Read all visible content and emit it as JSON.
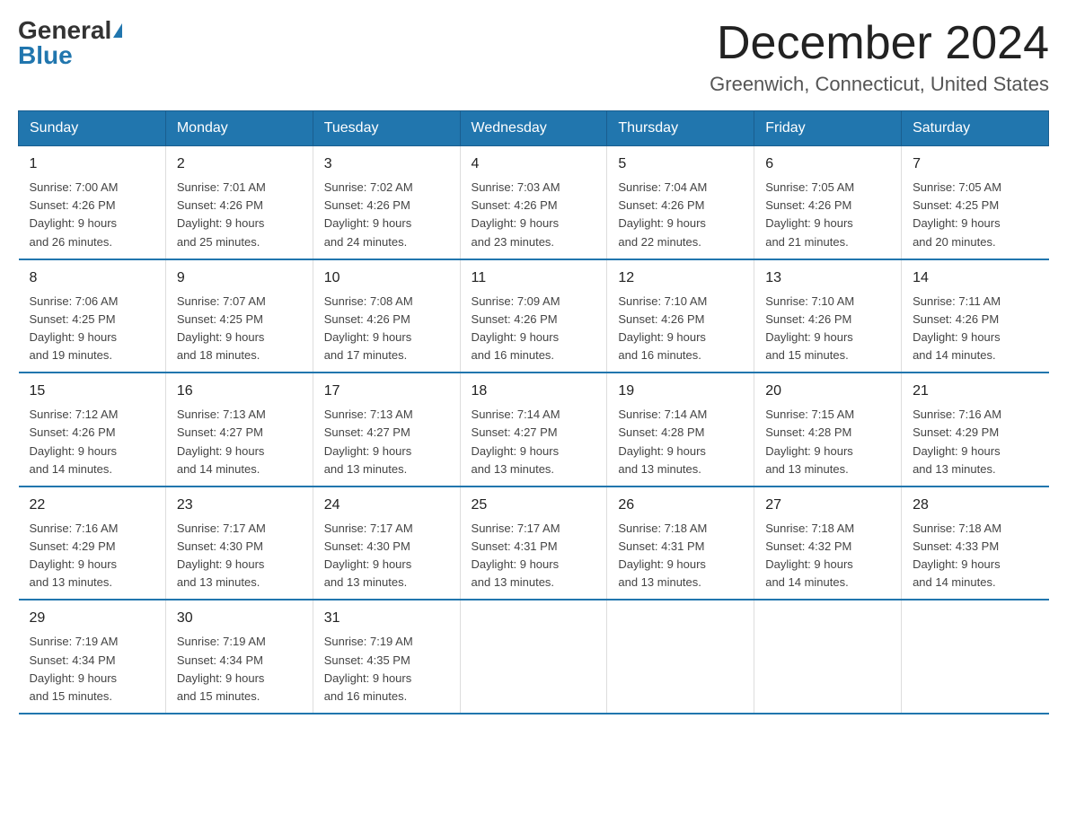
{
  "logo": {
    "general": "General",
    "blue": "Blue"
  },
  "header": {
    "month": "December 2024",
    "location": "Greenwich, Connecticut, United States"
  },
  "days_of_week": [
    "Sunday",
    "Monday",
    "Tuesday",
    "Wednesday",
    "Thursday",
    "Friday",
    "Saturday"
  ],
  "weeks": [
    [
      {
        "day": "1",
        "sunrise": "7:00 AM",
        "sunset": "4:26 PM",
        "daylight": "9 hours and 26 minutes."
      },
      {
        "day": "2",
        "sunrise": "7:01 AM",
        "sunset": "4:26 PM",
        "daylight": "9 hours and 25 minutes."
      },
      {
        "day": "3",
        "sunrise": "7:02 AM",
        "sunset": "4:26 PM",
        "daylight": "9 hours and 24 minutes."
      },
      {
        "day": "4",
        "sunrise": "7:03 AM",
        "sunset": "4:26 PM",
        "daylight": "9 hours and 23 minutes."
      },
      {
        "day": "5",
        "sunrise": "7:04 AM",
        "sunset": "4:26 PM",
        "daylight": "9 hours and 22 minutes."
      },
      {
        "day": "6",
        "sunrise": "7:05 AM",
        "sunset": "4:26 PM",
        "daylight": "9 hours and 21 minutes."
      },
      {
        "day": "7",
        "sunrise": "7:05 AM",
        "sunset": "4:25 PM",
        "daylight": "9 hours and 20 minutes."
      }
    ],
    [
      {
        "day": "8",
        "sunrise": "7:06 AM",
        "sunset": "4:25 PM",
        "daylight": "9 hours and 19 minutes."
      },
      {
        "day": "9",
        "sunrise": "7:07 AM",
        "sunset": "4:25 PM",
        "daylight": "9 hours and 18 minutes."
      },
      {
        "day": "10",
        "sunrise": "7:08 AM",
        "sunset": "4:26 PM",
        "daylight": "9 hours and 17 minutes."
      },
      {
        "day": "11",
        "sunrise": "7:09 AM",
        "sunset": "4:26 PM",
        "daylight": "9 hours and 16 minutes."
      },
      {
        "day": "12",
        "sunrise": "7:10 AM",
        "sunset": "4:26 PM",
        "daylight": "9 hours and 16 minutes."
      },
      {
        "day": "13",
        "sunrise": "7:10 AM",
        "sunset": "4:26 PM",
        "daylight": "9 hours and 15 minutes."
      },
      {
        "day": "14",
        "sunrise": "7:11 AM",
        "sunset": "4:26 PM",
        "daylight": "9 hours and 14 minutes."
      }
    ],
    [
      {
        "day": "15",
        "sunrise": "7:12 AM",
        "sunset": "4:26 PM",
        "daylight": "9 hours and 14 minutes."
      },
      {
        "day": "16",
        "sunrise": "7:13 AM",
        "sunset": "4:27 PM",
        "daylight": "9 hours and 14 minutes."
      },
      {
        "day": "17",
        "sunrise": "7:13 AM",
        "sunset": "4:27 PM",
        "daylight": "9 hours and 13 minutes."
      },
      {
        "day": "18",
        "sunrise": "7:14 AM",
        "sunset": "4:27 PM",
        "daylight": "9 hours and 13 minutes."
      },
      {
        "day": "19",
        "sunrise": "7:14 AM",
        "sunset": "4:28 PM",
        "daylight": "9 hours and 13 minutes."
      },
      {
        "day": "20",
        "sunrise": "7:15 AM",
        "sunset": "4:28 PM",
        "daylight": "9 hours and 13 minutes."
      },
      {
        "day": "21",
        "sunrise": "7:16 AM",
        "sunset": "4:29 PM",
        "daylight": "9 hours and 13 minutes."
      }
    ],
    [
      {
        "day": "22",
        "sunrise": "7:16 AM",
        "sunset": "4:29 PM",
        "daylight": "9 hours and 13 minutes."
      },
      {
        "day": "23",
        "sunrise": "7:17 AM",
        "sunset": "4:30 PM",
        "daylight": "9 hours and 13 minutes."
      },
      {
        "day": "24",
        "sunrise": "7:17 AM",
        "sunset": "4:30 PM",
        "daylight": "9 hours and 13 minutes."
      },
      {
        "day": "25",
        "sunrise": "7:17 AM",
        "sunset": "4:31 PM",
        "daylight": "9 hours and 13 minutes."
      },
      {
        "day": "26",
        "sunrise": "7:18 AM",
        "sunset": "4:31 PM",
        "daylight": "9 hours and 13 minutes."
      },
      {
        "day": "27",
        "sunrise": "7:18 AM",
        "sunset": "4:32 PM",
        "daylight": "9 hours and 14 minutes."
      },
      {
        "day": "28",
        "sunrise": "7:18 AM",
        "sunset": "4:33 PM",
        "daylight": "9 hours and 14 minutes."
      }
    ],
    [
      {
        "day": "29",
        "sunrise": "7:19 AM",
        "sunset": "4:34 PM",
        "daylight": "9 hours and 15 minutes."
      },
      {
        "day": "30",
        "sunrise": "7:19 AM",
        "sunset": "4:34 PM",
        "daylight": "9 hours and 15 minutes."
      },
      {
        "day": "31",
        "sunrise": "7:19 AM",
        "sunset": "4:35 PM",
        "daylight": "9 hours and 16 minutes."
      },
      null,
      null,
      null,
      null
    ]
  ],
  "labels": {
    "sunrise": "Sunrise:",
    "sunset": "Sunset:",
    "daylight": "Daylight:"
  }
}
